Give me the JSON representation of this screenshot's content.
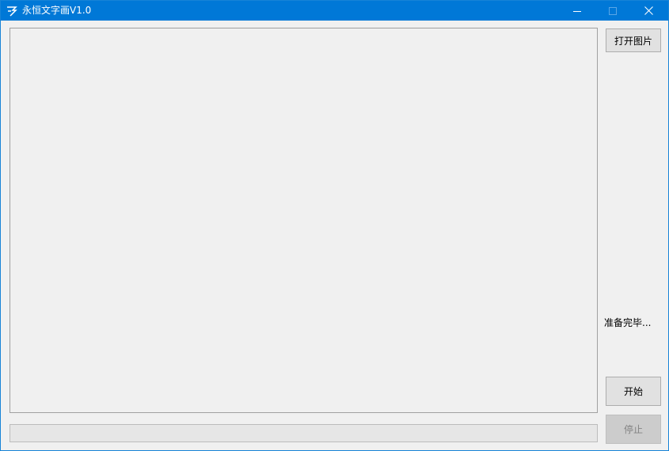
{
  "window": {
    "title": "永恒文字画V1.0",
    "controls": [
      "minimize-icon",
      "maximize-icon",
      "close-icon"
    ]
  },
  "toolbar": {
    "open_image_label": "打开图片",
    "start_label": "开始",
    "stop_label": "停止"
  },
  "status": {
    "text": "准备完毕..."
  },
  "progress": {
    "value": 0
  },
  "colors": {
    "titlebar": "#0078d7",
    "window_bg": "#f0f0f0",
    "button_bg": "#e1e1e1",
    "disabled_text": "#838383"
  }
}
